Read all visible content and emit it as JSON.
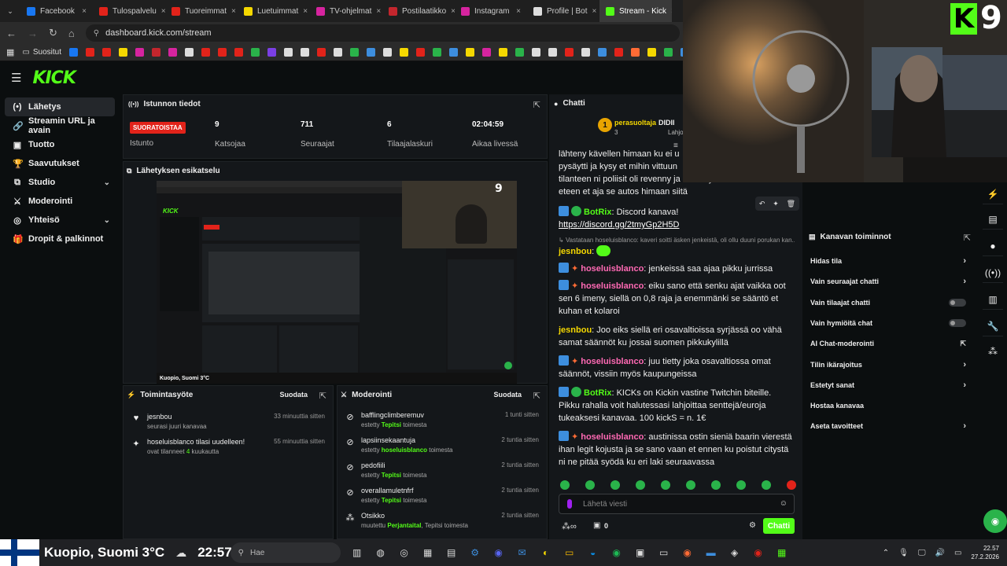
{
  "browser": {
    "tabs": [
      {
        "label": "Facebook",
        "color": "#1877f2"
      },
      {
        "label": "Tulospalvelu",
        "color": "#e2231a"
      },
      {
        "label": "Tuoreimmat",
        "color": "#e2231a"
      },
      {
        "label": "Luetuimmat",
        "color": "#f5d800"
      },
      {
        "label": "TV-ohjelmat",
        "color": "#d6249f"
      },
      {
        "label": "Postilaatikko",
        "color": "#c3262d"
      },
      {
        "label": "Instagram",
        "color": "#d6249f"
      },
      {
        "label": "Profile | Bot",
        "color": "#dddddd"
      },
      {
        "label": "Stream - Kick",
        "color": "#53fc18"
      }
    ],
    "url": "dashboard.kick.com/stream",
    "bookmarks_label": "Suositut"
  },
  "brand": {
    "logo": "KICK",
    "accent": "#53fc18"
  },
  "sidebar": {
    "items": [
      {
        "label": "Lähetys",
        "icon": "broadcast-icon"
      },
      {
        "label": "Streamin URL ja avain",
        "icon": "link-icon"
      },
      {
        "label": "Tuotto",
        "icon": "revenue-icon"
      },
      {
        "label": "Saavutukset",
        "icon": "trophy-icon"
      },
      {
        "label": "Studio",
        "icon": "studio-icon"
      },
      {
        "label": "Moderointi",
        "icon": "sword-icon"
      },
      {
        "label": "Yhteisö",
        "icon": "community-icon"
      },
      {
        "label": "Dropit & palkinnot",
        "icon": "gift-icon"
      }
    ]
  },
  "session": {
    "title": "Istunnon tiedot",
    "live_badge": "SUORATOISTAA",
    "session_label": "Istunto",
    "stats": [
      {
        "value": "9",
        "label": "Katsojaa"
      },
      {
        "value": "711",
        "label": "Seuraajat"
      },
      {
        "value": "6",
        "label": "Tilaajalaskuri"
      },
      {
        "value": "02:04:59",
        "label": "Aikaa livessä"
      }
    ]
  },
  "preview": {
    "title": "Lähetyksen esikatselu",
    "weather_overlay": "Kuopio, Suomi 3°C",
    "overlay_digit": "9"
  },
  "activity": {
    "title": "Toimintasyöte",
    "filter": "Suodata",
    "items": [
      {
        "user": "jesnbou",
        "text": "seurasi juuri kanavaa",
        "time": "33 minuuttia sitten"
      },
      {
        "user": "hoseluisblanco tilasi uudelleen!",
        "text_a": "ovat tilanneet ",
        "count": "4",
        "text_b": " kuukautta",
        "time": "55 minuuttia sitten"
      }
    ]
  },
  "moderation": {
    "title": "Moderointi",
    "filter": "Suodata",
    "items": [
      {
        "name": "bafflingclimberemuv",
        "a": "estetty ",
        "b": "Tepitsi",
        "c": " toimesta",
        "time": "1 tunti sitten"
      },
      {
        "name": "lapsiinsekaantuja",
        "a": "estetty ",
        "b": "hoseluisblanco",
        "c": " toimesta",
        "time": "2 tuntia sitten"
      },
      {
        "name": "pedofiili",
        "a": "estetty ",
        "b": "Tepitsi",
        "c": " toimesta",
        "time": "2 tuntia sitten"
      },
      {
        "name": "overallamuletnfrf",
        "a": "estetty ",
        "b": "Tepitsi",
        "c": " toimesta",
        "time": "2 tuntia sitten"
      },
      {
        "name": "Otsikko",
        "a": "muutettu ",
        "b": "Perjantaital",
        "c": ", Tepitsi toimesta",
        "time": "2 tuntia sitten"
      }
    ]
  },
  "chat": {
    "title": "Chatti",
    "pinned_user": "perasuoltaja",
    "pinned_count": "3",
    "pinned_other": "DIDII",
    "pinned_other_sub": "Lahjo",
    "partial_lines": [
      "lähteny kävellen himaan ku ei u",
      "pysäytti ja kysy et mihin vittuun",
      "tilanteen ni poliisit oli revenny ja heittäny sen takas baariin",
      "eteen et aja se autos himaan siitä"
    ],
    "messages": [
      {
        "user": "BotRix",
        "text": "Discord kanava!",
        "link": "https://discord.gg/2tmyGp2H5D"
      },
      {
        "reply": "Vastataan hoseluisblanco: kaveri soitti äsken jenkeistä, oli ollu duuni porukan kan..."
      },
      {
        "user": "jesnbou",
        "text": ""
      },
      {
        "user": "hoseluisblanco",
        "text": "jenkeissä saa ajaa pikku jurrissa"
      },
      {
        "user": "hoseluisblanco",
        "text": "eiku sano että senku ajat vaikka oot sen 6 imeny, siellä on 0,8 raja ja enemmänki se sääntö et kuhan et kolaroi"
      },
      {
        "user": "jesnbou",
        "text": "Joo eiks siellä eri osavaltioissa syrjässä oo vähä samat säännöt ku jossai suomen pikkukylillä"
      },
      {
        "user": "hoseluisblanco",
        "text": "juu tietty joka osavaltiossa omat säännöt, vissiin myös kaupungeissa"
      },
      {
        "user": "BotRix",
        "text": "KICKs on Kickin vastine Twitchin biteille. Pikku rahalla voit halutessasi lahjoittaa senttejä/euroja tukeaksesi kanavaa. 100 kickS = n. 1€"
      },
      {
        "user": "hoseluisblanco",
        "text": "austinissa ostin sieniä baarin vierestä ihan legit kojusta ja se sano vaan et ennen ku poistut citystä ni ne pitää syödä ku eri laki seuraavassa"
      }
    ],
    "input_placeholder": "Lähetä viesti",
    "kicks_count": "0",
    "send_label": "Chatti"
  },
  "channel_actions": {
    "title": "Kanavan toiminnot",
    "items": [
      {
        "label": "Hidas tila",
        "kind": "chevron"
      },
      {
        "label": "Vain seuraajat chatti",
        "kind": "chevron"
      },
      {
        "label": "Vain tilaajat chatti",
        "kind": "toggle"
      },
      {
        "label": "Vain hymiöitä chat",
        "kind": "toggle"
      },
      {
        "label": "AI Chat-moderointi",
        "kind": "external"
      },
      {
        "label": "Tilin ikärajoitus",
        "kind": "chevron"
      },
      {
        "label": "Estetyt sanat",
        "kind": "chevron"
      },
      {
        "label": "Hostaa kanavaa",
        "kind": "none"
      },
      {
        "label": "Aseta tavoitteet",
        "kind": "chevron"
      }
    ]
  },
  "cam": {
    "overlay_digit": "9"
  },
  "taskbar": {
    "weather": "Kuopio, Suomi 3°C",
    "clock_overlay": "22:57",
    "search_placeholder": "Hae",
    "time": "22.57",
    "date": "27.2.2026"
  }
}
